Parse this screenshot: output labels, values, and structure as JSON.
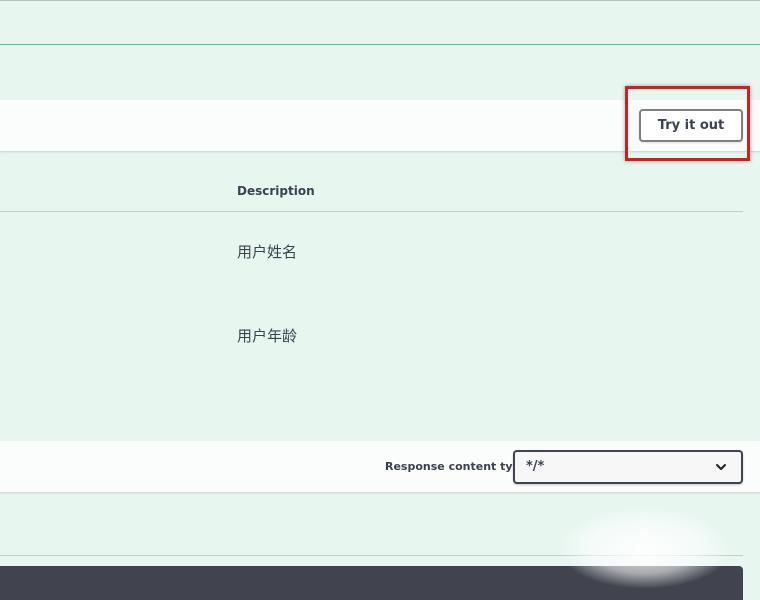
{
  "operation": {
    "try_it_out_label": "Try it out"
  },
  "parameters": {
    "description_header": "Description",
    "rows": [
      {
        "description": "用户姓名"
      },
      {
        "description": "用户年龄"
      }
    ]
  },
  "responses": {
    "content_type_label": "Response content type",
    "content_type_value": "*/*"
  },
  "colors": {
    "method_accent": "#49cc90",
    "highlight": "#d41d1d",
    "dark_bar": "#41444e"
  },
  "icons": {
    "select_arrow": "chevron-down-icon"
  }
}
